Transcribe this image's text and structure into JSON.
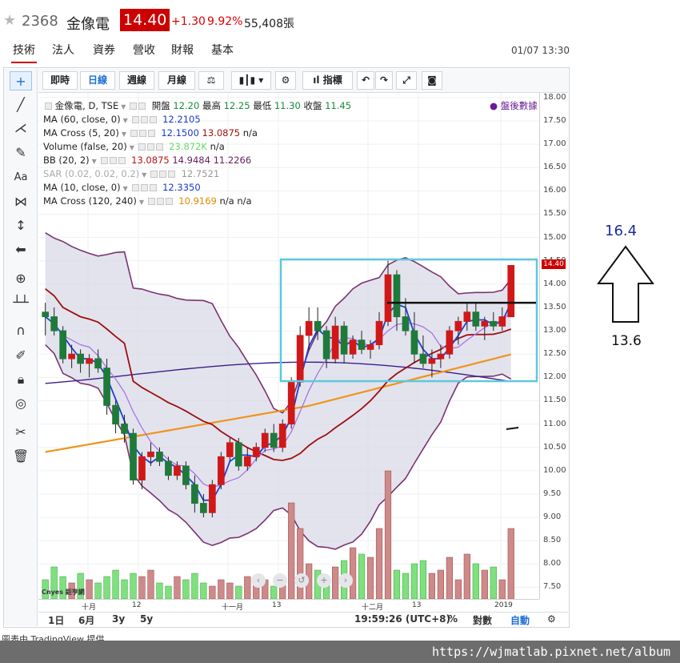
{
  "quote": {
    "star_icon": "star-icon",
    "code": "2368",
    "name": "金像電",
    "price": "14.40",
    "change": "+1.30",
    "percent": "9.92%",
    "volume": "55,408張"
  },
  "tabs": [
    "技術",
    "法人",
    "資券",
    "營收",
    "財報",
    "基本"
  ],
  "datetime": "01/07 13:30",
  "toolbar": {
    "buttons": [
      "即時",
      "日線",
      "週線",
      "月線"
    ],
    "indicators_label": "指標"
  },
  "legend": {
    "main": {
      "label": "金像電, D, TSE",
      "open_label": "開盤",
      "open": "12.20",
      "high_label": "最高",
      "high": "12.25",
      "low_label": "最低",
      "low": "11.30",
      "close_label": "收盤",
      "close": "11.45"
    },
    "rows": [
      {
        "label": "MA (60, close, 0)",
        "values": [
          "12.2105"
        ],
        "colors": [
          "#1a3cc8"
        ]
      },
      {
        "label": "MA Cross (5, 20)",
        "values": [
          "12.1500",
          "13.0875",
          "n/a"
        ],
        "colors": [
          "#1a3cc8",
          "#9e0f0f",
          "#222"
        ]
      },
      {
        "label": "Volume (false, 20)",
        "values": [
          "23.872K",
          "n/a"
        ],
        "colors": [
          "#66dd66",
          "#222"
        ]
      },
      {
        "label": "BB (20, 2)",
        "values": [
          "13.0875",
          "14.9484",
          "11.2266"
        ],
        "colors": [
          "#b11",
          "#6a2060",
          "#6a2060"
        ]
      },
      {
        "label": "SAR (0.02, 0.02, 0.2)",
        "values": [
          "12.7521"
        ],
        "colors": [
          "#999"
        ]
      },
      {
        "label": "MA (10, close, 0)",
        "values": [
          "12.3350"
        ],
        "colors": [
          "#1a3cc8"
        ]
      },
      {
        "label": "MA Cross (120, 240)",
        "values": [
          "10.9169",
          "n/a",
          "n/a"
        ],
        "colors": [
          "#e08a00",
          "#222",
          "#222"
        ]
      }
    ],
    "post_market": "● 盤後數據"
  },
  "yaxis": [
    "18.00",
    "17.50",
    "17.00",
    "16.50",
    "16.00",
    "15.50",
    "15.00",
    "14.50",
    "14.00",
    "13.50",
    "13.00",
    "12.50",
    "12.00",
    "11.50",
    "11.00",
    "10.50",
    "10.00",
    "9.50",
    "9.00",
    "8.50",
    "8.00",
    "7.50"
  ],
  "last_price_tag": "14.40",
  "xaxis": [
    "十月",
    "12",
    "十一月",
    "13",
    "十二月",
    "13",
    "2019"
  ],
  "watermark": "Cnyes 鉅亨網",
  "bottom": {
    "ranges": [
      "1日",
      "6月",
      "3y",
      "5y"
    ],
    "clock": "19:59:26 (UTC+8)",
    "percent": "%",
    "log": "對數",
    "auto": "自動",
    "gear_icon": "gear-icon"
  },
  "annotation": {
    "target": "16.4",
    "support": "13.6",
    "arrow_icon": "up-arrow-icon"
  },
  "footer": {
    "url": "https://wjmatlab.pixnet.net/album",
    "cut": "圖表由 TradingView 提供"
  },
  "chart_data": {
    "type": "candlestick",
    "ylim": [
      7.25,
      18.1
    ],
    "series": [
      {
        "name": "K",
        "ohlc": [
          [
            13.4,
            13.6,
            12.9,
            13.3
          ],
          [
            13.3,
            13.5,
            12.9,
            13.0
          ],
          [
            13.0,
            13.1,
            12.3,
            12.4
          ],
          [
            12.4,
            12.7,
            12.2,
            12.5
          ],
          [
            12.5,
            12.6,
            12.1,
            12.3
          ],
          [
            12.3,
            12.5,
            12.0,
            12.4
          ],
          [
            12.4,
            12.6,
            12.1,
            12.2
          ],
          [
            12.2,
            12.4,
            11.2,
            11.4
          ],
          [
            11.4,
            11.5,
            10.8,
            11.0
          ],
          [
            11.0,
            11.2,
            10.6,
            10.8
          ],
          [
            10.8,
            10.9,
            9.7,
            9.8
          ],
          [
            9.8,
            10.4,
            9.6,
            10.3
          ],
          [
            10.3,
            10.6,
            10.1,
            10.4
          ],
          [
            10.4,
            10.5,
            10.1,
            10.2
          ],
          [
            10.2,
            10.3,
            9.8,
            9.9
          ],
          [
            9.9,
            10.2,
            9.8,
            10.1
          ],
          [
            10.1,
            10.2,
            9.6,
            9.7
          ],
          [
            9.7,
            9.9,
            9.1,
            9.3
          ],
          [
            9.3,
            9.5,
            9.0,
            9.1
          ],
          [
            9.1,
            9.8,
            9.0,
            9.7
          ],
          [
            9.7,
            10.4,
            9.6,
            10.3
          ],
          [
            10.3,
            10.7,
            10.2,
            10.6
          ],
          [
            10.6,
            10.7,
            10.0,
            10.1
          ],
          [
            10.1,
            10.5,
            10.0,
            10.3
          ],
          [
            10.3,
            10.6,
            10.2,
            10.5
          ],
          [
            10.5,
            10.9,
            10.4,
            10.8
          ],
          [
            10.8,
            11.0,
            10.4,
            10.5
          ],
          [
            10.5,
            11.1,
            10.4,
            11.0
          ],
          [
            11.0,
            12.0,
            10.9,
            11.9
          ],
          [
            11.9,
            13.1,
            11.8,
            12.9
          ],
          [
            12.9,
            13.5,
            12.6,
            13.2
          ],
          [
            13.2,
            13.5,
            12.8,
            13.0
          ],
          [
            13.0,
            13.1,
            12.2,
            12.4
          ],
          [
            12.4,
            13.3,
            12.3,
            13.1
          ],
          [
            13.1,
            13.2,
            12.3,
            12.5
          ],
          [
            12.5,
            12.9,
            12.4,
            12.8
          ],
          [
            12.8,
            13.0,
            12.5,
            12.6
          ],
          [
            12.6,
            12.8,
            12.4,
            12.7
          ],
          [
            12.7,
            13.4,
            12.6,
            13.2
          ],
          [
            13.2,
            14.5,
            13.1,
            14.2
          ],
          [
            14.2,
            14.3,
            13.0,
            13.3
          ],
          [
            13.3,
            13.7,
            12.9,
            13.0
          ],
          [
            13.0,
            13.4,
            12.3,
            12.5
          ],
          [
            12.5,
            12.9,
            12.2,
            12.3
          ],
          [
            12.3,
            12.6,
            12.0,
            12.4
          ],
          [
            12.4,
            12.7,
            12.2,
            12.5
          ],
          [
            12.5,
            13.1,
            12.4,
            13.0
          ],
          [
            13.0,
            13.3,
            12.7,
            13.2
          ],
          [
            13.2,
            13.6,
            13.0,
            13.4
          ],
          [
            13.4,
            13.6,
            13.0,
            13.1
          ],
          [
            13.1,
            13.3,
            12.8,
            13.2
          ],
          [
            13.2,
            13.4,
            13.0,
            13.1
          ],
          [
            13.1,
            13.5,
            13.0,
            13.3
          ],
          [
            13.3,
            14.4,
            13.3,
            14.4
          ]
        ]
      }
    ],
    "volume": [
      6,
      10,
      7,
      5,
      8,
      6,
      5,
      7,
      9,
      6,
      8,
      7,
      9,
      5,
      4,
      7,
      6,
      8,
      5,
      4,
      6,
      5,
      4,
      7,
      5,
      6,
      4,
      5,
      30,
      22,
      11,
      9,
      7,
      10,
      12,
      16,
      14,
      13,
      22,
      40,
      9,
      8,
      11,
      12,
      8,
      9,
      13,
      6,
      14,
      11,
      9,
      10,
      6,
      22
    ],
    "overlays": [
      "MA60",
      "MA5",
      "MA10",
      "MA20",
      "MA120",
      "BB upper",
      "BB lower"
    ]
  }
}
